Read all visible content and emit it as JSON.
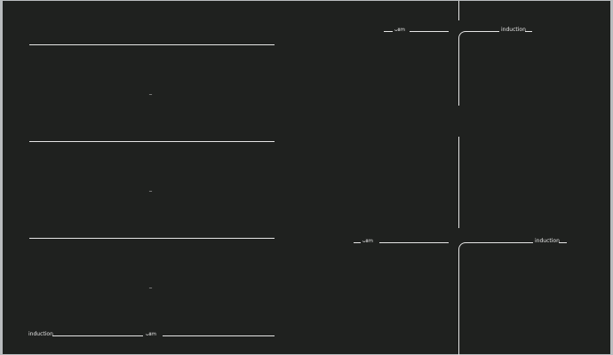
{
  "hob": {
    "left_panel": {
      "zone_markers": [
        "_",
        "_",
        "_"
      ],
      "bottom_label": "induction",
      "bottom_brand": "ᴗᴕꭑ"
    },
    "right_panel": {
      "top_brand": "ᴗᴕꭑ",
      "top_label": "induction",
      "bottom_brand": "ᴗᴕꭑ",
      "bottom_label": "induction"
    }
  }
}
